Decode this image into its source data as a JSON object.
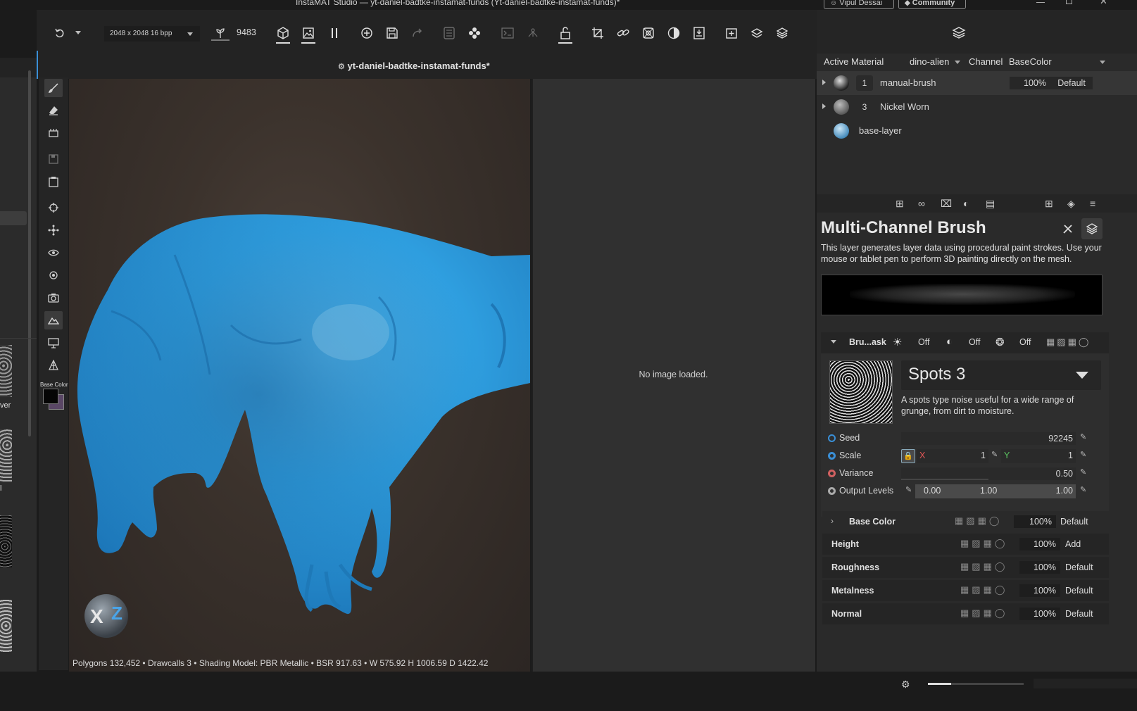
{
  "window": {
    "title": "InstaMAT Studio — yt-daniel-badtke-instamat-funds (Yt-daniel-badtke-instamat-funds)*",
    "user": "Vipul Dessai",
    "community_label": "Community"
  },
  "toolbar": {
    "resolution": "2048 x 2048 16 bpp",
    "seed_value": "9483"
  },
  "viewport": {
    "project_tab": "yt-daniel-badtke-instamat-funds*",
    "status": "Polygons 132,452 • Drawcalls 3 • Shading Model: PBR Metallic • BSR 917.63 • W 575.92 H 1006.59 D 1422.42",
    "no_image": "No image loaded.",
    "base_color_label": "Base Color",
    "side_labels": [
      "ver",
      "l"
    ]
  },
  "layers": {
    "active_material_label": "Active Material",
    "active_material": "dino-alien",
    "channel_label": "Channel",
    "channel_value": "BaseColor",
    "items": [
      {
        "index": "1",
        "name": "manual-brush",
        "opacity": "100%",
        "blend": "Default"
      },
      {
        "index": "3",
        "name": "Nickel Worn"
      },
      {
        "index": "",
        "name": "base-layer"
      }
    ]
  },
  "properties": {
    "title": "Multi-Channel Brush",
    "description": "This layer generates layer data using procedural paint strokes. Use your mouse or tablet pen to perform 3D painting directly on the mesh.",
    "mask_section": {
      "label": "Bru...ask",
      "toggles": [
        "Off",
        "Off",
        "Off"
      ]
    },
    "generator": {
      "name": "Spots 3",
      "description": "A spots type noise useful for a wide range of grunge, from dirt to moisture."
    },
    "params": {
      "seed_label": "Seed",
      "seed_value": "92245",
      "scale_label": "Scale",
      "scale_x_label": "X",
      "scale_x": "1",
      "scale_y_label": "Y",
      "scale_y": "1",
      "variance_label": "Variance",
      "variance_value": "0.50",
      "variance_fraction": 0.5,
      "output_label": "Output Levels",
      "output_min": "0.00",
      "output_mid": "1.00",
      "output_max": "1.00"
    },
    "channels": [
      {
        "name": "Base Color",
        "opacity": "100%",
        "blend": "Default"
      },
      {
        "name": "Height",
        "opacity": "100%",
        "blend": "Add"
      },
      {
        "name": "Roughness",
        "opacity": "100%",
        "blend": "Default"
      },
      {
        "name": "Metalness",
        "opacity": "100%",
        "blend": "Default"
      },
      {
        "name": "Normal",
        "opacity": "100%",
        "blend": "Default"
      }
    ]
  },
  "colors": {
    "accent_blue": "#3a8fd6",
    "panel_bg": "#2a2a2a",
    "viewport_bg": "#3b322c",
    "model_blue": "#2f9fe0"
  }
}
